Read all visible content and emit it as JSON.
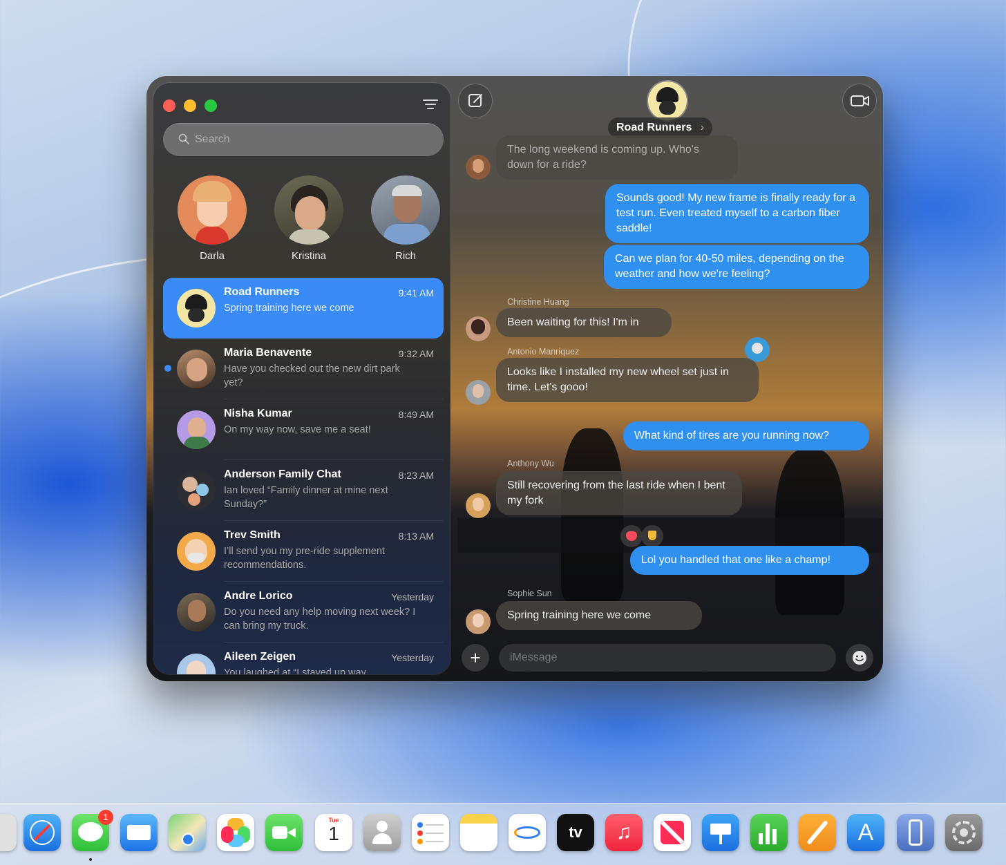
{
  "sidebar": {
    "search_placeholder": "Search",
    "pinned": [
      {
        "name": "Darla"
      },
      {
        "name": "Kristina"
      },
      {
        "name": "Rich"
      }
    ],
    "conversations": [
      {
        "title": "Road Runners",
        "time": "9:41 AM",
        "preview": "Spring training here we come",
        "selected": true
      },
      {
        "title": "Maria Benavente",
        "time": "9:32 AM",
        "preview": "Have you checked out the new dirt park yet?",
        "unread": true
      },
      {
        "title": "Nisha Kumar",
        "time": "8:49 AM",
        "preview": "On my way now, save me a seat!"
      },
      {
        "title": "Anderson Family Chat",
        "time": "8:23 AM",
        "preview": "Ian loved “Family dinner at mine next Sunday?”"
      },
      {
        "title": "Trev Smith",
        "time": "8:13 AM",
        "preview": "I’ll send you my pre-ride supplement recommendations."
      },
      {
        "title": "Andre Lorico",
        "time": "Yesterday",
        "preview": "Do you need any help moving next week? I can bring my truck."
      },
      {
        "title": "Aileen Zeigen",
        "time": "Yesterday",
        "preview": "You laughed at “I stayed up way"
      }
    ]
  },
  "chat": {
    "group_name": "Road Runners",
    "input_placeholder": "iMessage",
    "messages": [
      {
        "dir": "in",
        "text": "The long weekend is coming up. Who's down for a ride?"
      },
      {
        "dir": "out",
        "text": "Sounds good! My new frame is finally ready for a test run. Even treated myself to a carbon fiber saddle!"
      },
      {
        "dir": "out",
        "text": "Can we plan for 40-50 miles, depending on the weather and how we're feeling?"
      },
      {
        "dir": "in",
        "sender": "Christine Huang",
        "text": "Been waiting for this! I'm in"
      },
      {
        "dir": "in",
        "sender": "Antonio Manriquez",
        "text": "Looks like I installed my new wheel set just in time. Let's gooo!"
      },
      {
        "dir": "out",
        "text": "What kind of tires are you running now?"
      },
      {
        "dir": "in",
        "sender": "Anthony Wu",
        "text": "Still recovering from the last ride when I bent my fork"
      },
      {
        "dir": "out",
        "text": "Lol you handled that one like a champ!"
      },
      {
        "dir": "in",
        "sender": "Sophie Sun",
        "text": "Spring training here we come"
      }
    ]
  },
  "dock": {
    "messages_badge": "1",
    "calendar_month": "Tue",
    "calendar_day": "1",
    "tv_label": "tv",
    "apps": [
      "launchpad",
      "safari",
      "messages",
      "mail",
      "maps",
      "photos",
      "facetime",
      "calendar",
      "contacts",
      "reminders",
      "notes",
      "freeform",
      "tv",
      "music",
      "news",
      "keynote",
      "numbers",
      "pages",
      "app-store",
      "iphone-mirroring",
      "system-settings"
    ]
  },
  "colors": {
    "accent": "#3a8bf6",
    "outgoing_bubble": "#2f90ef",
    "badge": "#ff3b30"
  }
}
